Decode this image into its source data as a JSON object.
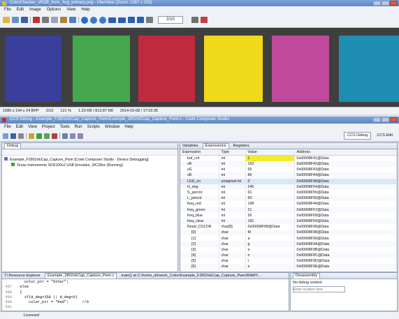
{
  "irfan": {
    "title": "ColorChecker_sRGB_from_Avg_primary.png - IrfanView (Zoom: 1367 x 233)",
    "menu": [
      "File",
      "Edit",
      "Image",
      "Options",
      "View",
      "Help"
    ],
    "page_counter": "2/10",
    "swatch_colors": [
      "#3a3e9c",
      "#46a84e",
      "#c02a3e",
      "#f0d81a",
      "#c04a9c",
      "#1e8eb2"
    ],
    "status": [
      "1089 x 194 x 24 BPP",
      "2/10",
      "121 %",
      "1.23 KB / 813.87 KB",
      "2014-03-08 / 17:03:35"
    ]
  },
  "ccs": {
    "title": "CCS Debug - Example_F2802xECap_Capture_Pwm/Example_2802xECap_Capture_Pwm.c - Code Composer Studio",
    "menu": [
      "File",
      "Edit",
      "View",
      "Project",
      "Tools",
      "Run",
      "Scripts",
      "Window",
      "Help"
    ],
    "perspectives": [
      "CCS Debug",
      "CCS Edit"
    ],
    "debug": {
      "tab": "Debug",
      "items": [
        "Example_F2802xECap_Capture_Pwm [Code Composer Studio - Device Debugging]",
        "Texas Instruments XDS100v2 USB Emulator_0/C28xx (Running)"
      ]
    },
    "variables": {
      "tabs": [
        "Variables",
        "Expressions",
        "Registers"
      ],
      "headers": [
        "Expression",
        "Type",
        "Value",
        "Address"
      ],
      "rows": [
        [
          "buf_cnt",
          "int",
          "1",
          "0x00008F41@Data"
        ],
        [
          "sR",
          "int",
          "152",
          "0x00008F42@Data"
        ],
        [
          "sG",
          "int",
          "55",
          "0x00008F43@Data"
        ],
        [
          "sB",
          "int",
          "80",
          "0x00008F44@Data"
        ],
        [
          "LED_on",
          "unsigned int",
          "0",
          "0x00008F48@Data"
        ],
        [
          "H_deg",
          "int",
          "245",
          "0x00008F54@Data"
        ],
        [
          "S_percnt",
          "int",
          "61",
          "0x00008F55@Data"
        ],
        [
          "L_percnt",
          "int",
          "50",
          "0x00008F56@Data"
        ],
        [
          "freq_red",
          "int",
          "108",
          "0x00008F44@Data"
        ],
        [
          "freq_green",
          "int",
          "21",
          "0x00008F57@Data"
        ],
        [
          "freq_blue",
          "int",
          "56",
          "0x00008F58@Data"
        ],
        [
          "freq_clear",
          "int",
          "181",
          "0x00008F59@Data"
        ],
        [
          "Read_COLOR",
          "char[8]",
          "0x00008F98@Data",
          "0x00008F98@Data"
        ],
        [
          "[0]",
          "char",
          "M",
          "0x00008F98@Data"
        ],
        [
          "[1]",
          "char",
          "a",
          "0x00008F99@Data"
        ],
        [
          "[2]",
          "char",
          "g",
          "0x00008F9A@Data"
        ],
        [
          "[3]",
          "char",
          "e",
          "0x00008F9B@Data"
        ],
        [
          "[4]",
          "char",
          "n",
          "0x00008F9C@Data"
        ],
        [
          "[5]",
          "char",
          "t",
          "0x00008F9D@Data"
        ],
        [
          "[6]",
          "char",
          "e",
          "0x00008F9E@Data"
        ]
      ]
    },
    "editor": {
      "tabs": [
        "TI Resource Explorer",
        "Example_2802xECap_Capture_Pwm.c",
        "main() at C:\\home_dir\\work_Color\\Example_F2802xECap_Capture_Pwm\\RAMY..."
      ],
      "lines": [
        {
          "n": "",
          "t": "    color_ptr = \"Other\";"
        },
        {
          "n": "497",
          "t": "  else"
        },
        {
          "n": "498",
          "t": "  {"
        },
        {
          "n": "499",
          "t": "    if(H_deg>350 || H_deg<6)"
        },
        {
          "n": "500",
          "t": "      color_ptr = \"Red\";      //0"
        },
        {
          "n": "501",
          "t": ""
        }
      ]
    },
    "disassembly": {
      "tab": "Disassembly",
      "message": "No debug context",
      "placeholder": "Enter location here"
    },
    "status": "Licensed"
  }
}
